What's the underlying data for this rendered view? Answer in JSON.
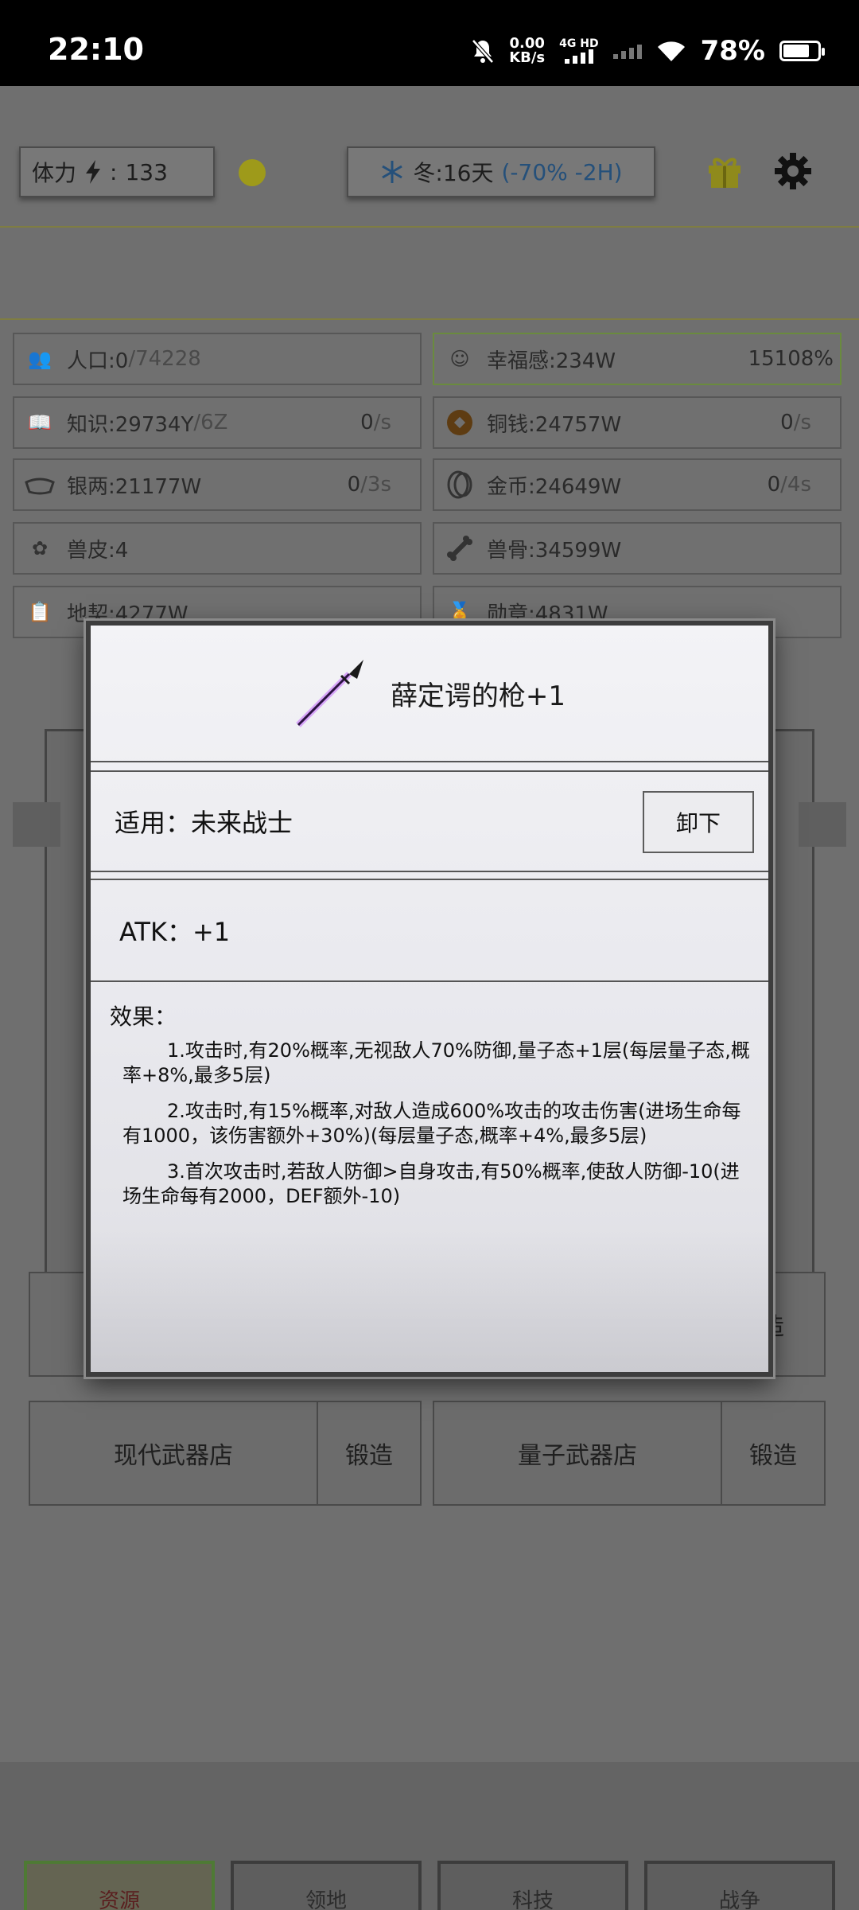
{
  "status_bar": {
    "time": "22:10",
    "speed_value": "0.00",
    "speed_unit": "KB/s",
    "network": "4G HD",
    "battery": "78%"
  },
  "top": {
    "stamina_label": "体力",
    "stamina_value": "133",
    "season_text": "冬:16天",
    "season_mod": "(-70% -2H)"
  },
  "resources": [
    {
      "icon": "people-icon",
      "label": "人口:0",
      "extra": "/74228",
      "rate": ""
    },
    {
      "icon": "smile-icon",
      "label": "幸福感:234W",
      "extra": "",
      "rate": "15108%"
    },
    {
      "icon": "book-icon",
      "label": "知识:29734Y",
      "extra": "/6Z",
      "rate": "0",
      "rate_unit": "/s"
    },
    {
      "icon": "coin-icon",
      "label": "铜钱:24757W",
      "extra": "",
      "rate": "0",
      "rate_unit": "/s"
    },
    {
      "icon": "ingot-icon",
      "label": "银两:21177W",
      "extra": "",
      "rate": "0",
      "rate_unit": "/3s"
    },
    {
      "icon": "gold-icon",
      "label": "金币:24649W",
      "extra": "",
      "rate": "0",
      "rate_unit": "/4s"
    },
    {
      "icon": "hide-icon",
      "label": "兽皮:4",
      "extra": "",
      "rate": ""
    },
    {
      "icon": "bone-icon",
      "label": "兽骨:34599W",
      "extra": "",
      "rate": ""
    },
    {
      "icon": "deed-icon",
      "label": "地契:4277W",
      "extra": "",
      "rate": ""
    },
    {
      "icon": "medal-icon",
      "label": "勋章:4831W",
      "extra": "",
      "rate": ""
    }
  ],
  "shops": {
    "forge_partial": "造",
    "modern_shop": "现代武器店",
    "quantum_shop": "量子武器店",
    "forge": "锻造"
  },
  "tabs": [
    "资源",
    "领地",
    "科技",
    "战争"
  ],
  "dialog": {
    "title": "薛定谔的枪+1",
    "apply_label": "适用：未来战士",
    "unequip": "卸下",
    "atk": "ATK：+1",
    "effects_header": "效果：",
    "effect_1": "1.攻击时,有20%概率,无视敌人70%防御,量子态+1层(每层量子态,概率+8%,最多5层)",
    "effect_2": "2.攻击时,有15%概率,对敌人造成600%攻击的攻击伤害(进场生命每有1000，该伤害额外+30%)(每层量子态,概率+4%,最多5层)",
    "effect_3": "3.首次攻击时,若敌人防御>自身攻击,有50%概率,使敌人防御-10(进场生命每有2000，DEF额外-10)"
  },
  "colors": {
    "accent_green": "#6a8b3e",
    "spear_glow": "#b94cff",
    "season_negative": "#25507a"
  }
}
